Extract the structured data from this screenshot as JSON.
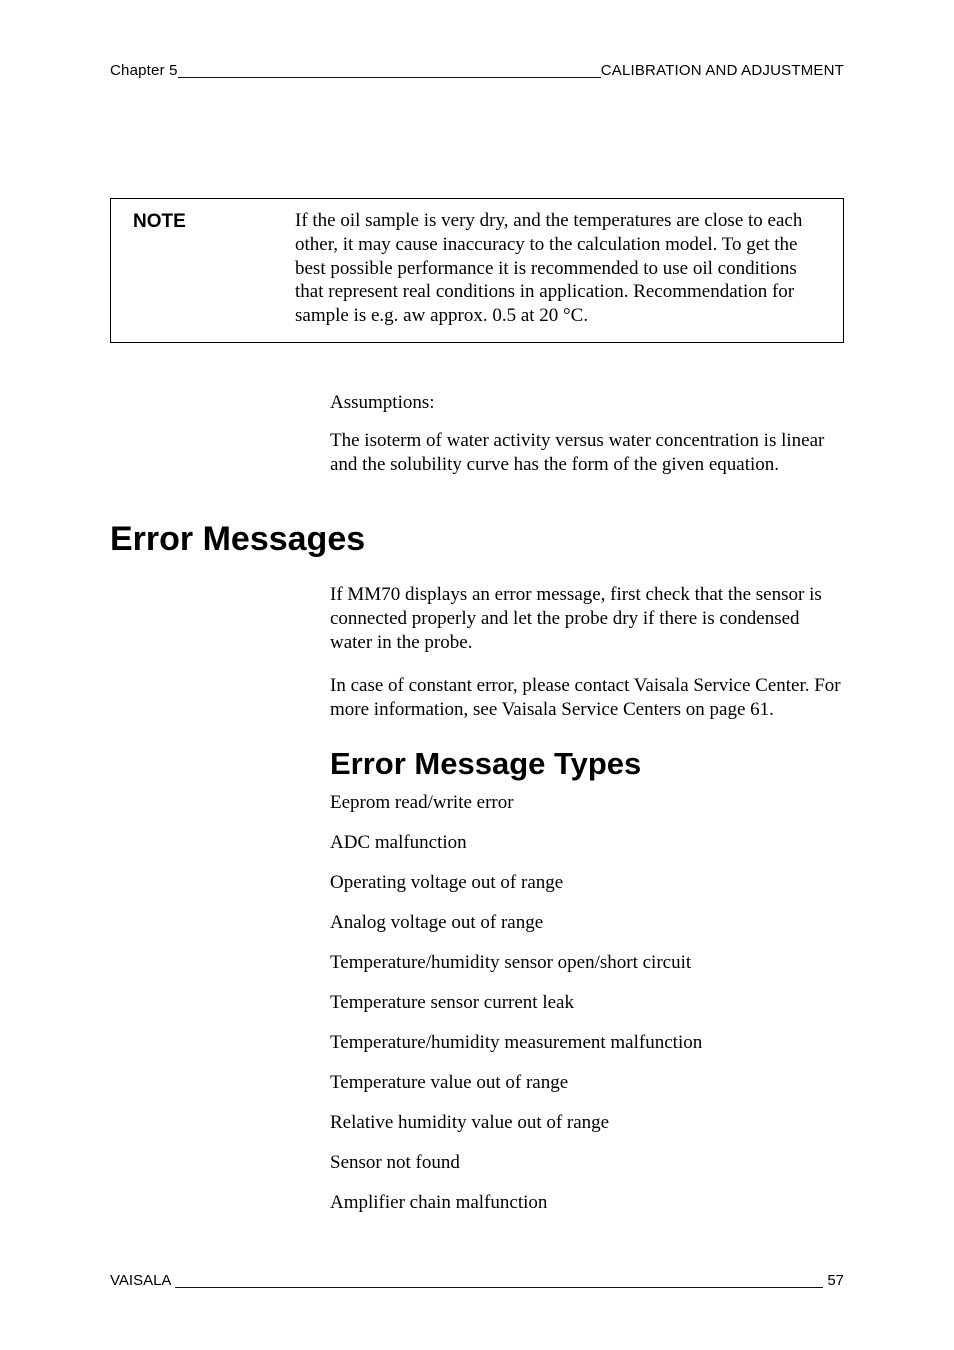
{
  "header": {
    "left": "Chapter 5",
    "right": "CALIBRATION AND ADJUSTMENT"
  },
  "note": {
    "label": "NOTE",
    "body": "If the oil sample is very dry, and the temperatures are close to each other, it may cause inaccuracy to the calculation model. To get the best possible performance it is recommended to use oil conditions that represent real conditions in application. Recommendation for sample is e.g. aw approx. 0.5 at 20 °C."
  },
  "assumptions_label": "Assumptions:",
  "isoterm_para": "The isoterm of water activity versus water concentration is linear and the solubility curve has the form of the given equation.",
  "h1_error_messages": "Error Messages",
  "mm70_para": "If MM70 displays an error message, first check that the sensor is connected properly and let the probe dry if there is condensed water in the probe.",
  "const_err_para": "In case of constant error, please contact Vaisala Service Center. For more information, see Vaisala Service Centers on page 61.",
  "h2_error_types": "Error Message Types",
  "errors": [
    "Eeprom read/write error",
    "ADC malfunction",
    "Operating voltage out of range",
    "Analog voltage out of range",
    "Temperature/humidity sensor open/short circuit",
    "Temperature sensor current leak",
    "Temperature/humidity measurement malfunction",
    "Temperature value out of range",
    "Relative humidity value out of range",
    "Sensor not found",
    "Amplifier chain malfunction"
  ],
  "footer": {
    "left": "VAISALA",
    "page": "57"
  }
}
